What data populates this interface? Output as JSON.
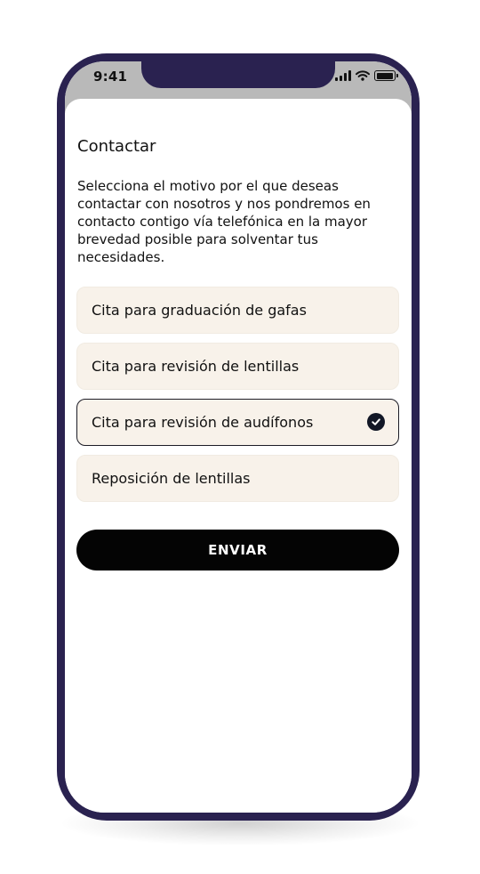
{
  "status_bar": {
    "time": "9:41",
    "icons": [
      "signal-icon",
      "wifi-icon",
      "battery-icon"
    ]
  },
  "page": {
    "title": "Contactar",
    "description": "Selecciona el motivo por el que deseas contactar con nosotros y nos pondremos en contacto contigo vía telefónica en la mayor brevedad posible para solventar tus necesidades."
  },
  "options": [
    {
      "label": "Cita para graduación de gafas",
      "selected": false
    },
    {
      "label": "Cita para revisión de lentillas",
      "selected": false
    },
    {
      "label": "Cita para revisión de audífonos",
      "selected": true
    },
    {
      "label": "Reposición de lentillas",
      "selected": false
    }
  ],
  "submit": {
    "label": "ENVIAR"
  },
  "colors": {
    "frame": "#2a2250",
    "option_background": "#f8f2ea",
    "selected_border": "#1c1c26",
    "button_background": "#040404",
    "button_text": "#ffffff"
  }
}
